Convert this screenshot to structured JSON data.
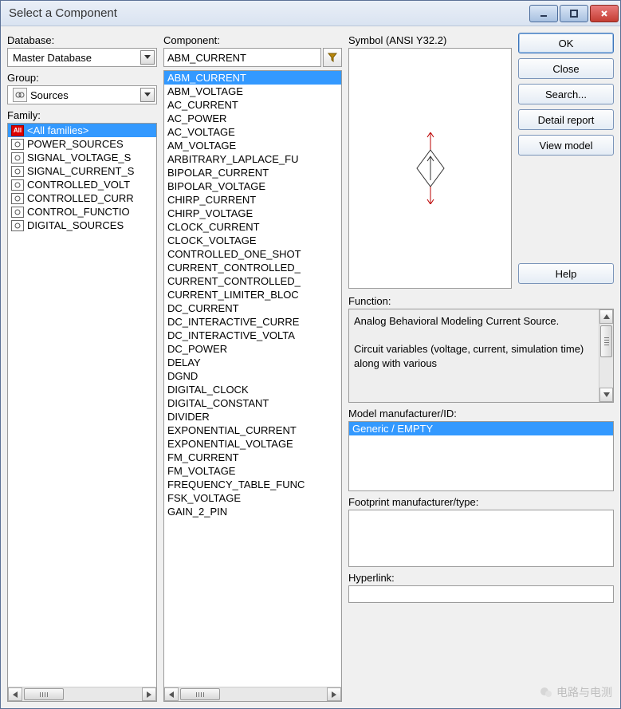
{
  "window": {
    "title": "Select a Component"
  },
  "labels": {
    "database": "Database:",
    "group": "Group:",
    "family": "Family:",
    "component": "Component:",
    "symbol": "Symbol (ANSI Y32.2)",
    "function": "Function:",
    "model": "Model manufacturer/ID:",
    "footprint": "Footprint manufacturer/type:",
    "hyperlink": "Hyperlink:"
  },
  "database": {
    "selected": "Master Database"
  },
  "group": {
    "selected": "Sources"
  },
  "component_value": "ABM_CURRENT",
  "families": [
    "<All families>",
    "POWER_SOURCES",
    "SIGNAL_VOLTAGE_S",
    "SIGNAL_CURRENT_S",
    "CONTROLLED_VOLT",
    "CONTROLLED_CURR",
    "CONTROL_FUNCTIO",
    "DIGITAL_SOURCES"
  ],
  "components": [
    "ABM_CURRENT",
    "ABM_VOLTAGE",
    "AC_CURRENT",
    "AC_POWER",
    "AC_VOLTAGE",
    "AM_VOLTAGE",
    "ARBITRARY_LAPLACE_FU",
    "BIPOLAR_CURRENT",
    "BIPOLAR_VOLTAGE",
    "CHIRP_CURRENT",
    "CHIRP_VOLTAGE",
    "CLOCK_CURRENT",
    "CLOCK_VOLTAGE",
    "CONTROLLED_ONE_SHOT",
    "CURRENT_CONTROLLED_",
    "CURRENT_CONTROLLED_",
    "CURRENT_LIMITER_BLOC",
    "DC_CURRENT",
    "DC_INTERACTIVE_CURRE",
    "DC_INTERACTIVE_VOLTA",
    "DC_POWER",
    "DELAY",
    "DGND",
    "DIGITAL_CLOCK",
    "DIGITAL_CONSTANT",
    "DIVIDER",
    "EXPONENTIAL_CURRENT",
    "EXPONENTIAL_VOLTAGE",
    "FM_CURRENT",
    "FM_VOLTAGE",
    "FREQUENCY_TABLE_FUNC",
    "FSK_VOLTAGE",
    "GAIN_2_PIN"
  ],
  "buttons": {
    "ok": "OK",
    "close": "Close",
    "search": "Search...",
    "detail": "Detail report",
    "view": "View model",
    "help": "Help"
  },
  "function_text": "Analog Behavioral Modeling Current Source.\n\nCircuit variables (voltage, current, simulation time) along with various",
  "model_item": "Generic / EMPTY",
  "watermark": "电路与电测"
}
